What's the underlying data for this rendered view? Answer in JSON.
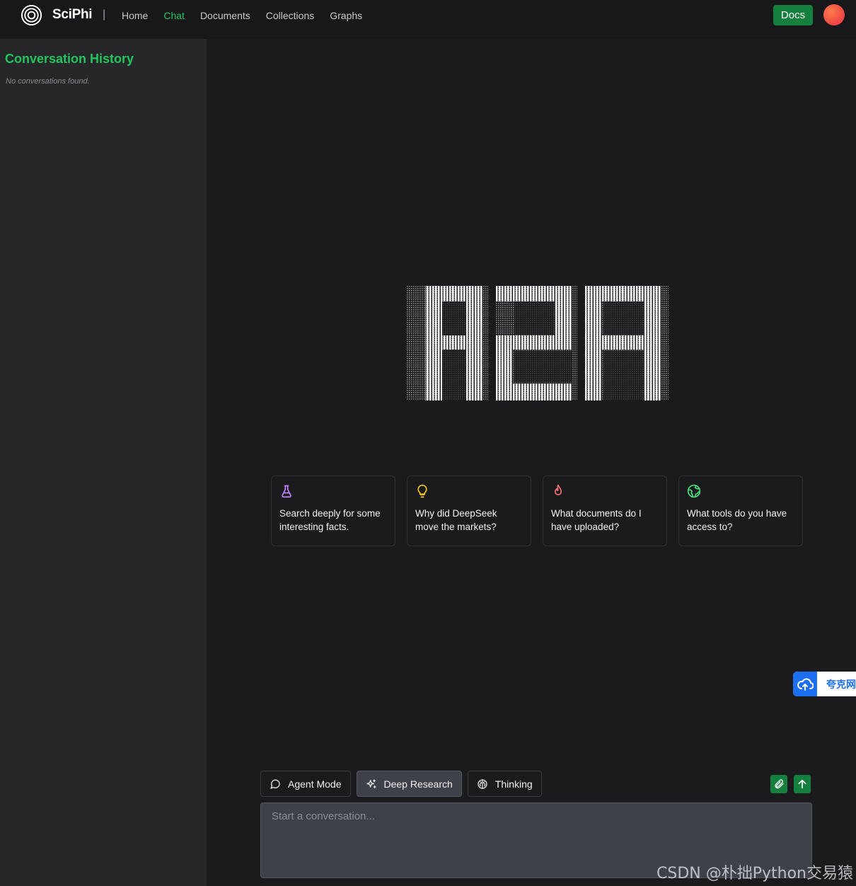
{
  "header": {
    "brand": "SciPhi",
    "separator": "|",
    "nav": [
      {
        "label": "Home",
        "active": false
      },
      {
        "label": "Chat",
        "active": true
      },
      {
        "label": "Documents",
        "active": false
      },
      {
        "label": "Collections",
        "active": false
      },
      {
        "label": "Graphs",
        "active": false
      }
    ],
    "docs_label": "Docs"
  },
  "sidebar": {
    "title": "Conversation History",
    "empty_text": "No conversations found."
  },
  "main": {
    "logo_icon": "ascii-r2r-logo",
    "suggestions": [
      {
        "icon": "flask-icon",
        "color": "#c084fc",
        "text": "Search deeply for some interesting facts."
      },
      {
        "icon": "lightbulb-icon",
        "color": "#facc15",
        "text": "Why did DeepSeek move the markets?"
      },
      {
        "icon": "flame-icon",
        "color": "#f87171",
        "text": "What documents do I have uploaded?"
      },
      {
        "icon": "globe-icon",
        "color": "#4ade80",
        "text": "What tools do you have access to?"
      }
    ],
    "modes": [
      {
        "icon": "chat-bubble-icon",
        "label": "Agent Mode",
        "active": false
      },
      {
        "icon": "sparkles-icon",
        "label": "Deep Research",
        "active": true
      },
      {
        "icon": "brain-icon",
        "label": "Thinking",
        "active": false
      }
    ],
    "input_placeholder": "Start a conversation..."
  },
  "cloud_widget": {
    "label": "夸克网"
  },
  "watermark": "CSDN @朴拙Python交易猿",
  "colors": {
    "accent": "#22c55e",
    "button_green": "#15803d",
    "background": "#1b1b1e",
    "sidebar": "#27272a"
  }
}
